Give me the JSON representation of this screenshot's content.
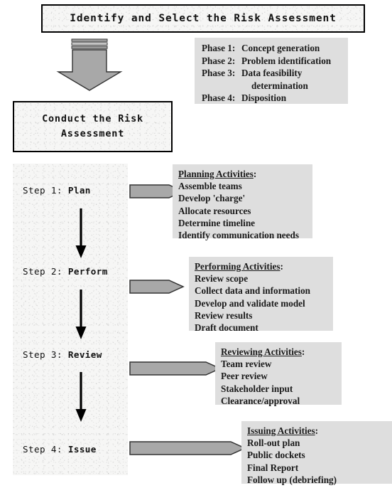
{
  "diagram": {
    "title_box": {
      "text": "Identify and Select the Risk Assessment"
    },
    "conduct_box": {
      "line1": "Conduct the Risk",
      "line2": "Assessment"
    },
    "phase_box": {
      "rows": [
        {
          "label": "Phase 1:",
          "value": "Concept generation"
        },
        {
          "label": "Phase 2:",
          "value": "Problem identification"
        },
        {
          "label": "Phase 3:",
          "value": "Data feasibility"
        },
        {
          "label": "",
          "value": "determination"
        },
        {
          "label": "Phase 4:",
          "value": "Disposition"
        }
      ]
    },
    "steps": [
      {
        "prefix": "Step 1:",
        "name": "Plan"
      },
      {
        "prefix": "Step 2:",
        "name": "Perform"
      },
      {
        "prefix": "Step 3:",
        "name": "Review"
      },
      {
        "prefix": "Step 4:",
        "name": "Issue"
      }
    ],
    "callouts": [
      {
        "heading": "Planning Activities",
        "heading_suffix": ":",
        "items": [
          "Assemble teams",
          "Develop 'charge'",
          "Allocate resources",
          "Determine timeline",
          "Identify communication needs"
        ]
      },
      {
        "heading": "Performing Activities",
        "heading_suffix": ":",
        "items": [
          "Review scope",
          "Collect data and information",
          "Develop and validate model",
          "Review results",
          "Draft document"
        ]
      },
      {
        "heading": "Reviewing Activities",
        "heading_suffix": ":",
        "items": [
          "Team review",
          "Peer review",
          "Stakeholder input",
          "Clearance/approval"
        ]
      },
      {
        "heading": "Issuing Activities",
        "heading_suffix": ":",
        "items": [
          "Roll-out plan",
          "Public dockets",
          "Final Report",
          "Follow up (debriefing)"
        ]
      }
    ],
    "colors": {
      "callout_background": "#dedede",
      "arrow_fill": "#a8a8a8",
      "arrow_stroke": "#333333",
      "border": "#000000",
      "text": "#1a1a1a"
    }
  }
}
